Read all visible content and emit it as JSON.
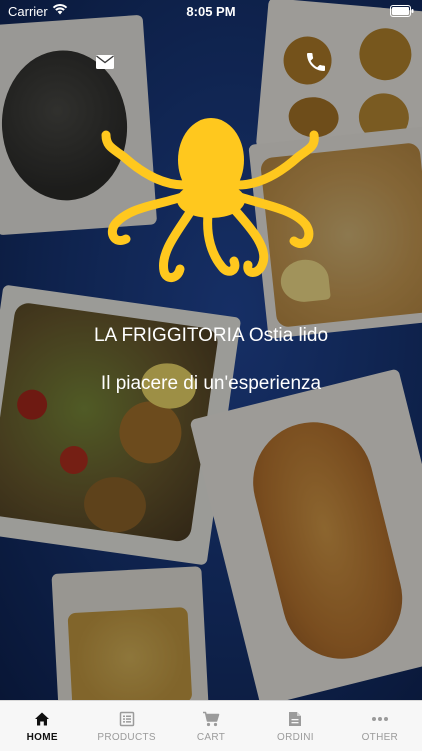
{
  "status_bar": {
    "carrier": "Carrier",
    "time": "8:05 PM",
    "wifi_icon": "wifi-icon",
    "battery_icon": "battery-icon"
  },
  "header": {
    "mail_icon": "mail-icon",
    "phone_icon": "phone-icon"
  },
  "brand": {
    "logo": "octopus-logo",
    "logo_color": "#FFC81E",
    "title": "LA FRIGGITORIA Ostia lido",
    "subtitle": "Il piacere di un'esperienza"
  },
  "tab_bar": {
    "active_index": 0,
    "tabs": [
      {
        "label": "HOME",
        "icon": "home-icon"
      },
      {
        "label": "PRODUCTS",
        "icon": "list-icon"
      },
      {
        "label": "CART",
        "icon": "cart-icon"
      },
      {
        "label": "ORDINI",
        "icon": "document-icon"
      },
      {
        "label": "OTHER",
        "icon": "more-icon"
      }
    ]
  },
  "colors": {
    "background_blue": "#173575",
    "tab_active": "#111111",
    "tab_inactive": "#9B9B9B"
  }
}
